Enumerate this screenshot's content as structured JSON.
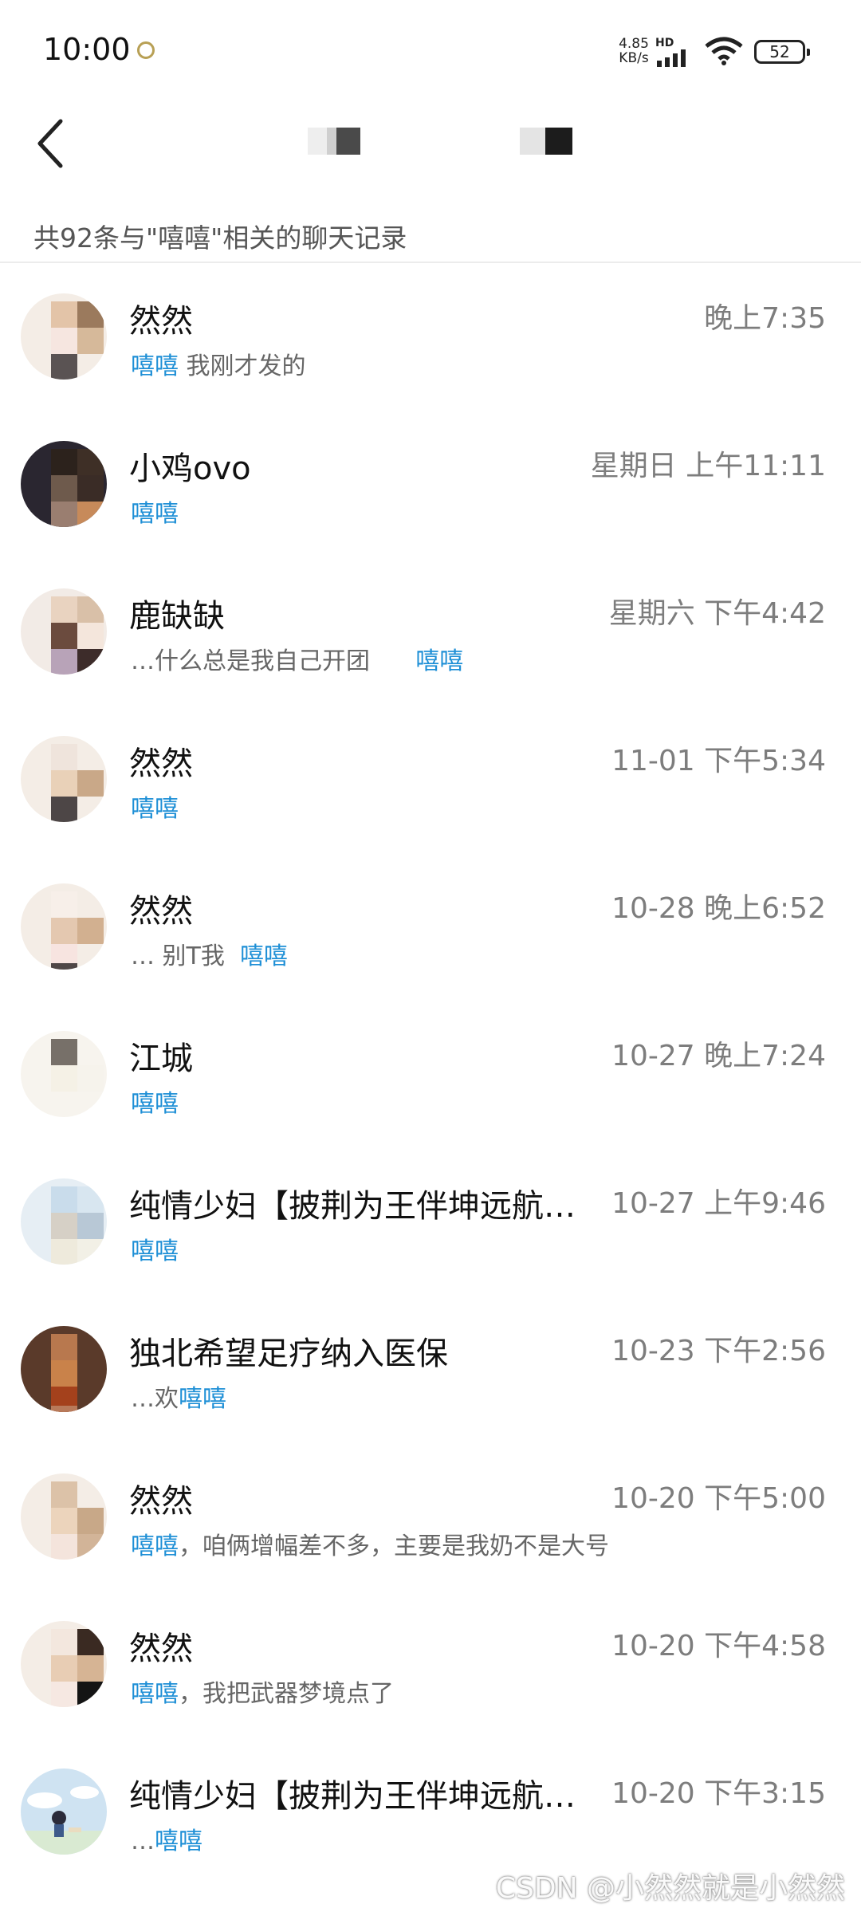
{
  "status_bar": {
    "time": "10:00",
    "net_speed": "4.85\nKB/s",
    "hd": "HD",
    "battery": "52"
  },
  "results": {
    "summary": "共92条与\"嘻嘻\"相关的聊天记录"
  },
  "highlight_color": "#1e8fd6",
  "chats": [
    {
      "name": "然然",
      "time": "晚上7:35",
      "pre": "",
      "hl": "嘻嘻",
      "post": " 我刚才发的"
    },
    {
      "name": "小鸡ovo",
      "time": "星期日 上午11:11",
      "pre": "",
      "hl": "嘻嘻",
      "post": ""
    },
    {
      "name": "鹿缺缺",
      "time": "星期六 下午4:42",
      "pre": "…什么总是我自己开团      ",
      "hl": "嘻嘻",
      "post": ""
    },
    {
      "name": "然然",
      "time": "11-01 下午5:34",
      "pre": "",
      "hl": "嘻嘻",
      "post": ""
    },
    {
      "name": "然然",
      "time": "10-28 晚上6:52",
      "pre": "… 别T我  ",
      "hl": "嘻嘻",
      "post": ""
    },
    {
      "name": "江城",
      "time": "10-27 晚上7:24",
      "pre": "",
      "hl": "嘻嘻",
      "post": ""
    },
    {
      "name": "纯情少妇【披荆为王伴坤远航…",
      "time": "10-27 上午9:46",
      "pre": "",
      "hl": "嘻嘻",
      "post": ""
    },
    {
      "name": "独北希望足疗纳入医保",
      "time": "10-23 下午2:56",
      "pre": "…欢",
      "hl": "嘻嘻",
      "post": ""
    },
    {
      "name": "然然",
      "time": "10-20 下午5:00",
      "pre": "",
      "hl": "嘻嘻",
      "post": "，咱俩增幅差不多，主要是我奶不是大号"
    },
    {
      "name": "然然",
      "time": "10-20 下午4:58",
      "pre": "",
      "hl": "嘻嘻",
      "post": "，我把武器梦境点了"
    },
    {
      "name": "纯情少妇【披荆为王伴坤远航…",
      "time": "10-20 下午3:15",
      "pre": "…",
      "hl": "嘻嘻",
      "post": ""
    }
  ],
  "watermark": "CSDN @小然然就是小然然"
}
